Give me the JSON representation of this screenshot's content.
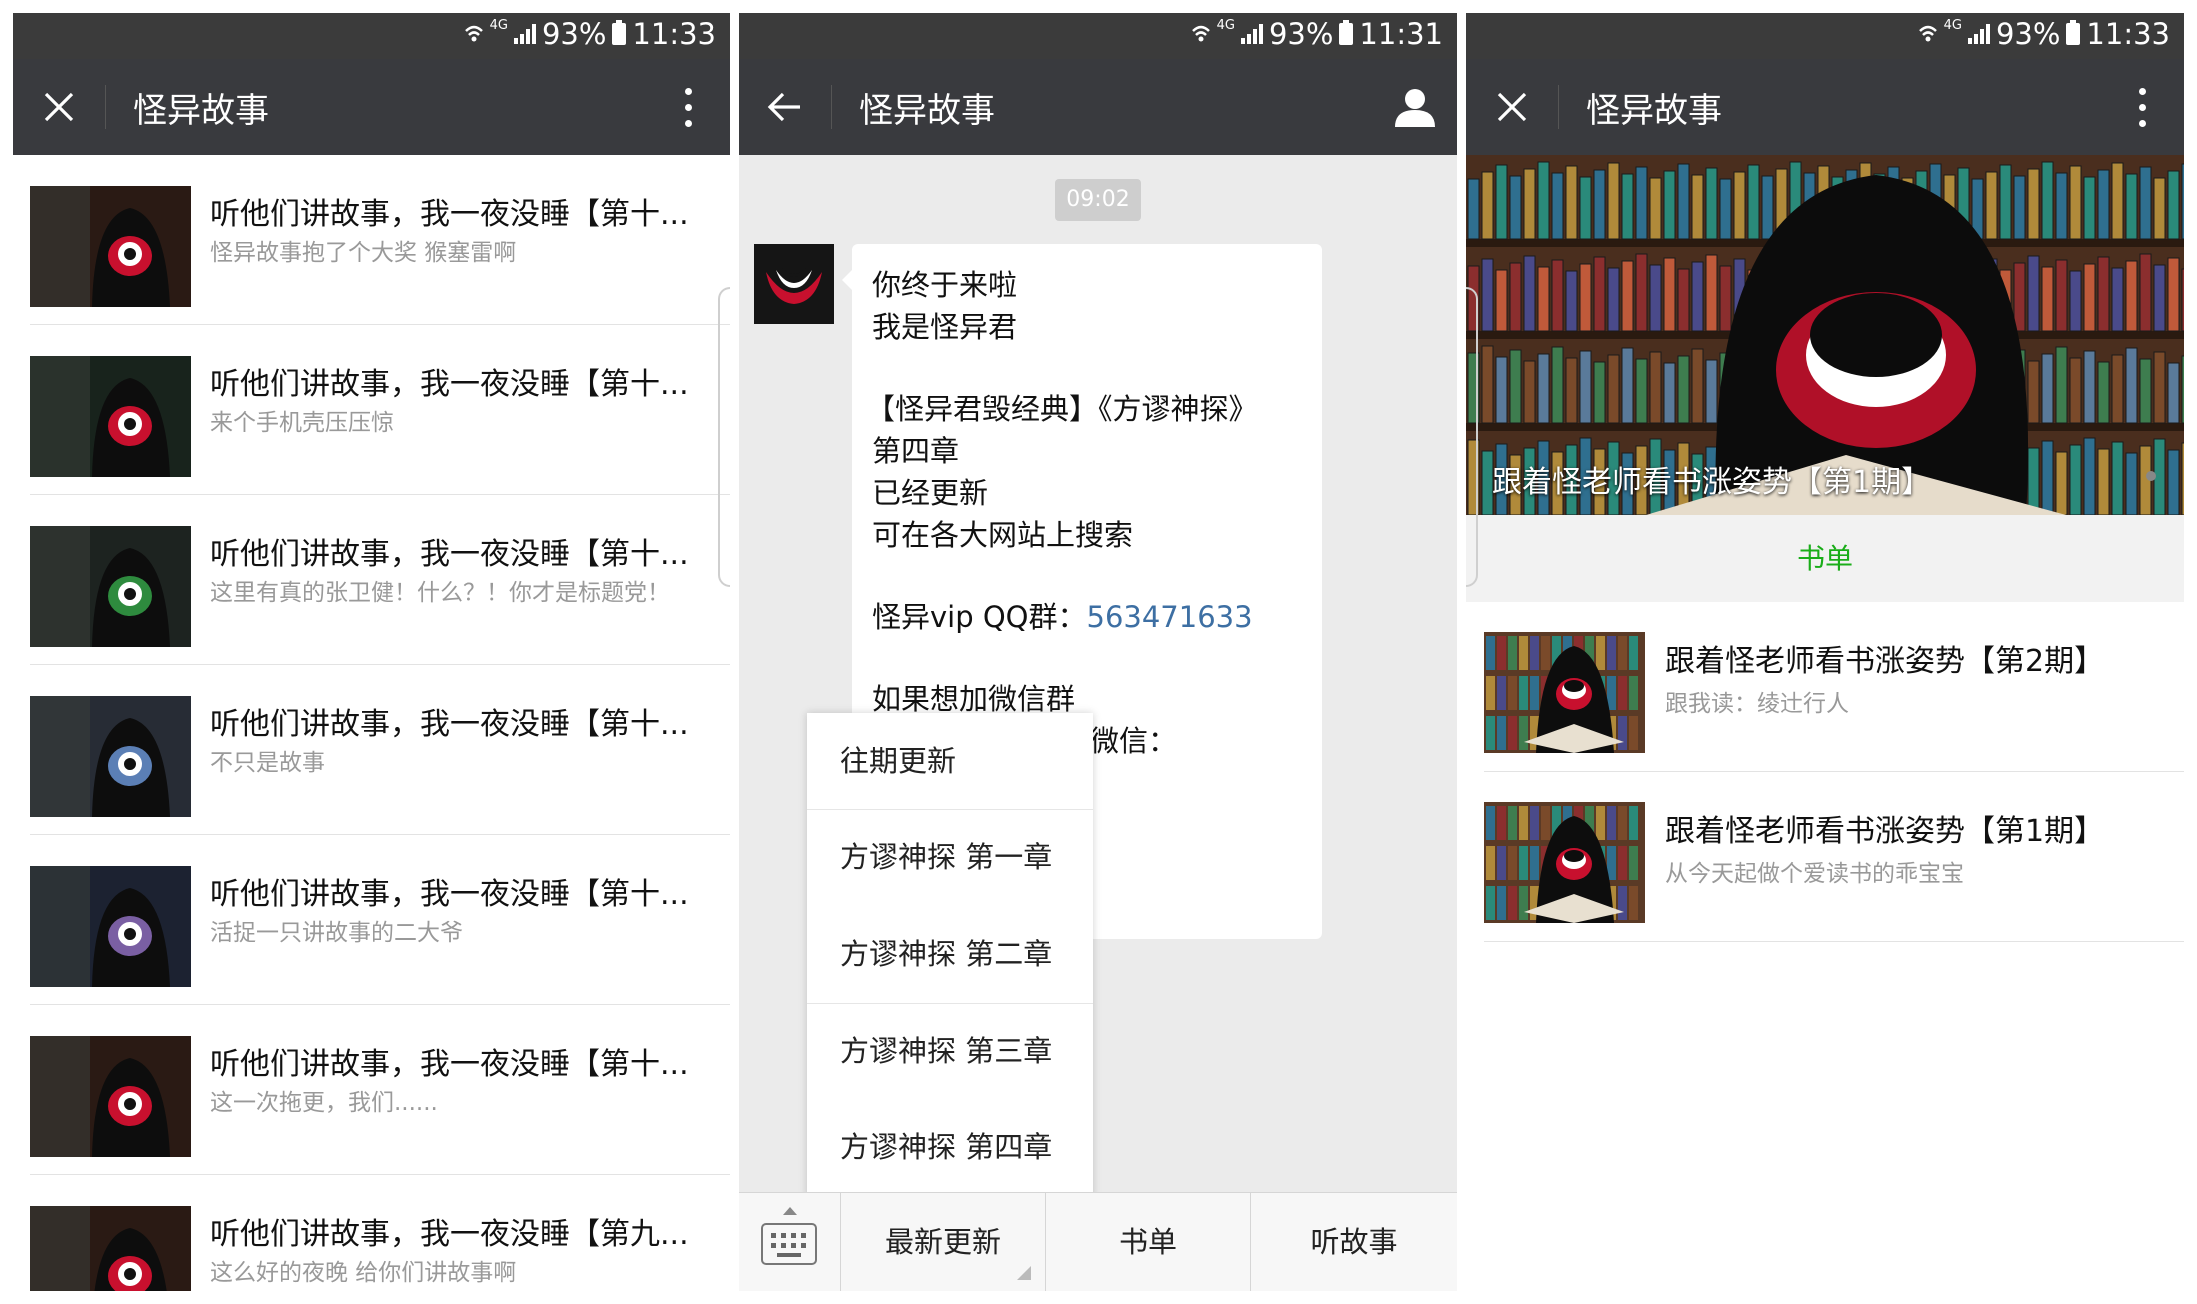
{
  "status": {
    "network": "4G",
    "battery": "93%",
    "time_left": "11:33",
    "time_middle": "11:31",
    "time_right": "11:33"
  },
  "panel1": {
    "title": "怪异故事",
    "articles": [
      {
        "title": "听他们讲故事，我一夜没睡【第十...",
        "sub": "怪异故事抱了个大奖 猴塞雷啊",
        "thumb_tone": "red"
      },
      {
        "title": "听他们讲故事，我一夜没睡【第十...",
        "sub": "来个手机壳压压惊",
        "thumb_tone": "green-dark"
      },
      {
        "title": "听他们讲故事，我一夜没睡【第十...",
        "sub": "这里有真的张卫健！什么？！你才是标题党！",
        "thumb_tone": "green"
      },
      {
        "title": "听他们讲故事，我一夜没睡【第十...",
        "sub": "不只是故事",
        "thumb_tone": "blue"
      },
      {
        "title": "听他们讲故事，我一夜没睡【第十...",
        "sub": "活捉一只讲故事的二大爷",
        "thumb_tone": "purple"
      },
      {
        "title": "听他们讲故事，我一夜没睡【第十...",
        "sub": "这一次拖更，我们......",
        "thumb_tone": "red"
      },
      {
        "title": "听他们讲故事，我一夜没睡【第九...",
        "sub": "这么好的夜晚 给你们讲故事啊",
        "thumb_tone": "red"
      }
    ]
  },
  "panel2": {
    "title": "怪异故事",
    "time_badge": "09:02",
    "message_lines": [
      "你终于来啦",
      "我是怪异君",
      "【怪异君毁经典】《方谬神探》",
      "第四章",
      "已经更新",
      "可在各大网站上搜索",
      "怪异vip QQ群：",
      "563471633",
      "如果想加微信群",
      "微信："
    ],
    "popup_items": [
      "往期更新",
      "方谬神探 第一章",
      "方谬神探 第二章",
      "方谬神探 第三章",
      "方谬神探 第四章"
    ],
    "menu": [
      "最新更新",
      "书单",
      "听故事"
    ]
  },
  "panel3": {
    "title": "怪异故事",
    "banner_caption": "跟着怪老师看书涨姿势【第1期】",
    "tab_label": "书单",
    "accent": "#1aad19",
    "articles": [
      {
        "title": "跟着怪老师看书涨姿势【第2期】",
        "sub": "跟我读：绫辻行人"
      },
      {
        "title": "跟着怪老师看书涨姿势【第1期】",
        "sub": "从今天起做个爱读书的乖宝宝"
      }
    ]
  }
}
